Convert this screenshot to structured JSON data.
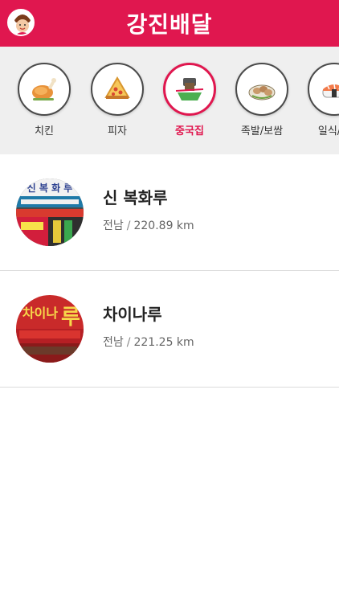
{
  "header": {
    "title": "강진배달",
    "brand_color": "#e0174f",
    "avatar_icon": "chef-avatar-icon"
  },
  "categories": [
    {
      "label": "치킨",
      "icon": "chicken-icon",
      "active": false
    },
    {
      "label": "피자",
      "icon": "pizza-icon",
      "active": false
    },
    {
      "label": "중국집",
      "icon": "chinese-food-icon",
      "active": true
    },
    {
      "label": "족발/보쌈",
      "icon": "jokbal-icon",
      "active": false
    },
    {
      "label": "일식/돈",
      "icon": "sushi-icon",
      "active": false
    }
  ],
  "restaurants": [
    {
      "name": "신 복화루",
      "region": "전남",
      "separator": "/",
      "distance": "220.89 km",
      "thumb": "restaurant-photo"
    },
    {
      "name": "차이나루",
      "region": "전남",
      "separator": "/",
      "distance": "221.25 km",
      "thumb": "restaurant-photo"
    }
  ]
}
